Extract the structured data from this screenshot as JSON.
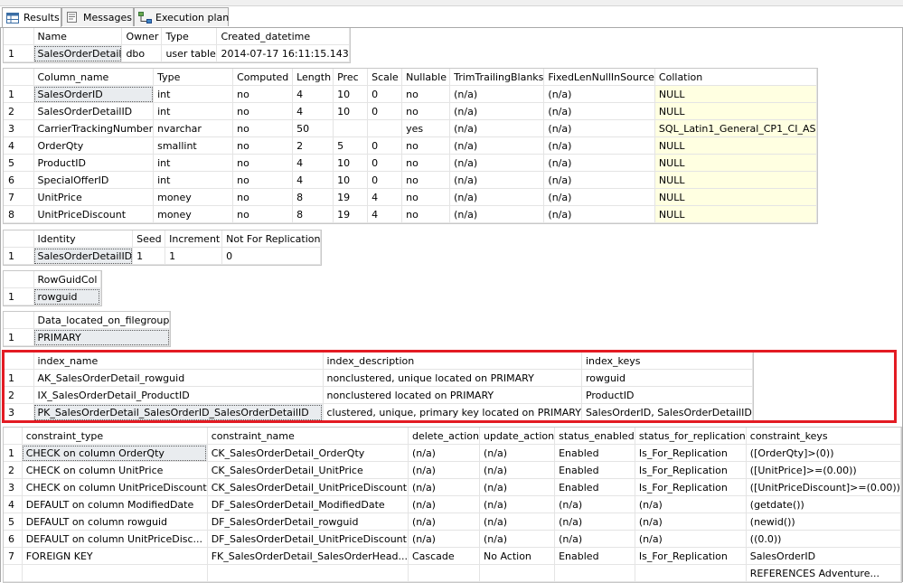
{
  "tabs": [
    {
      "label": "Results",
      "icon": "grid-icon",
      "active": true
    },
    {
      "label": "Messages",
      "icon": "messages-icon",
      "active": false
    },
    {
      "label": "Execution plan",
      "icon": "execution-plan-icon",
      "active": false
    }
  ],
  "grids": {
    "table_info": {
      "columns": [
        "Name",
        "Owner",
        "Type",
        "Created_datetime"
      ],
      "rows": [
        [
          "1",
          "SalesOrderDetail",
          "dbo",
          "user table",
          "2014-07-17 16:11:15.143"
        ]
      ]
    },
    "columns_info": {
      "columns": [
        "Column_name",
        "Type",
        "Computed",
        "Length",
        "Prec",
        "Scale",
        "Nullable",
        "TrimTrailingBlanks",
        "FixedLenNullInSource",
        "Collation"
      ],
      "rows": [
        [
          "1",
          "SalesOrderID",
          "int",
          "no",
          "4",
          "10",
          "0",
          "no",
          "(n/a)",
          "(n/a)",
          "NULL"
        ],
        [
          "2",
          "SalesOrderDetailID",
          "int",
          "no",
          "4",
          "10",
          "0",
          "no",
          "(n/a)",
          "(n/a)",
          "NULL"
        ],
        [
          "3",
          "CarrierTrackingNumber",
          "nvarchar",
          "no",
          "50",
          "",
          "",
          "yes",
          "(n/a)",
          "(n/a)",
          "SQL_Latin1_General_CP1_CI_AS"
        ],
        [
          "4",
          "OrderQty",
          "smallint",
          "no",
          "2",
          "5",
          "0",
          "no",
          "(n/a)",
          "(n/a)",
          "NULL"
        ],
        [
          "5",
          "ProductID",
          "int",
          "no",
          "4",
          "10",
          "0",
          "no",
          "(n/a)",
          "(n/a)",
          "NULL"
        ],
        [
          "6",
          "SpecialOfferID",
          "int",
          "no",
          "4",
          "10",
          "0",
          "no",
          "(n/a)",
          "(n/a)",
          "NULL"
        ],
        [
          "7",
          "UnitPrice",
          "money",
          "no",
          "8",
          "19",
          "4",
          "no",
          "(n/a)",
          "(n/a)",
          "NULL"
        ],
        [
          "8",
          "UnitPriceDiscount",
          "money",
          "no",
          "8",
          "19",
          "4",
          "no",
          "(n/a)",
          "(n/a)",
          "NULL"
        ]
      ]
    },
    "identity": {
      "columns": [
        "Identity",
        "Seed",
        "Increment",
        "Not For Replication"
      ],
      "rows": [
        [
          "1",
          "SalesOrderDetailID",
          "1",
          "1",
          "0"
        ]
      ]
    },
    "rowguid": {
      "columns": [
        "RowGuidCol"
      ],
      "rows": [
        [
          "1",
          "rowguid"
        ]
      ]
    },
    "filegroup": {
      "columns": [
        "Data_located_on_filegroup"
      ],
      "rows": [
        [
          "1",
          "PRIMARY"
        ]
      ]
    },
    "indexes": {
      "columns": [
        "index_name",
        "index_description",
        "index_keys"
      ],
      "rows": [
        [
          "1",
          "AK_SalesOrderDetail_rowguid",
          "nonclustered, unique located on PRIMARY",
          "rowguid"
        ],
        [
          "2",
          "IX_SalesOrderDetail_ProductID",
          "nonclustered located on PRIMARY",
          "ProductID"
        ],
        [
          "3",
          "PK_SalesOrderDetail_SalesOrderID_SalesOrderDetailID",
          "clustered, unique, primary key located on PRIMARY",
          "SalesOrderID, SalesOrderDetailID"
        ]
      ]
    },
    "constraints": {
      "columns": [
        "constraint_type",
        "constraint_name",
        "delete_action",
        "update_action",
        "status_enabled",
        "status_for_replication",
        "constraint_keys"
      ],
      "rows": [
        [
          "1",
          "CHECK on column OrderQty",
          "CK_SalesOrderDetail_OrderQty",
          "(n/a)",
          "(n/a)",
          "Enabled",
          "Is_For_Replication",
          "([OrderQty]>(0))"
        ],
        [
          "2",
          "CHECK on column UnitPrice",
          "CK_SalesOrderDetail_UnitPrice",
          "(n/a)",
          "(n/a)",
          "Enabled",
          "Is_For_Replication",
          "([UnitPrice]>=(0.00))"
        ],
        [
          "3",
          "CHECK on column UnitPriceDiscount",
          "CK_SalesOrderDetail_UnitPriceDiscount",
          "(n/a)",
          "(n/a)",
          "Enabled",
          "Is_For_Replication",
          "([UnitPriceDiscount]>=(0.00))"
        ],
        [
          "4",
          "DEFAULT on column ModifiedDate",
          "DF_SalesOrderDetail_ModifiedDate",
          "(n/a)",
          "(n/a)",
          "(n/a)",
          "(n/a)",
          "(getdate())"
        ],
        [
          "5",
          "DEFAULT on column rowguid",
          "DF_SalesOrderDetail_rowguid",
          "(n/a)",
          "(n/a)",
          "(n/a)",
          "(n/a)",
          "(newid())"
        ],
        [
          "6",
          "DEFAULT on column UnitPriceDisc...",
          "DF_SalesOrderDetail_UnitPriceDiscount",
          "(n/a)",
          "(n/a)",
          "(n/a)",
          "(n/a)",
          "((0.0))"
        ],
        [
          "7",
          "FOREIGN KEY",
          "FK_SalesOrderDetail_SalesOrderHead...",
          "Cascade",
          "No Action",
          "Enabled",
          "Is_For_Replication",
          "SalesOrderID"
        ],
        [
          "",
          "",
          "",
          "",
          "",
          "",
          "",
          "REFERENCES Adventure..."
        ]
      ]
    }
  },
  "colors": {
    "highlight_border": "#e31b23",
    "collation_background": "#ffffe1",
    "selected_cell_background": "#e9ecef"
  }
}
